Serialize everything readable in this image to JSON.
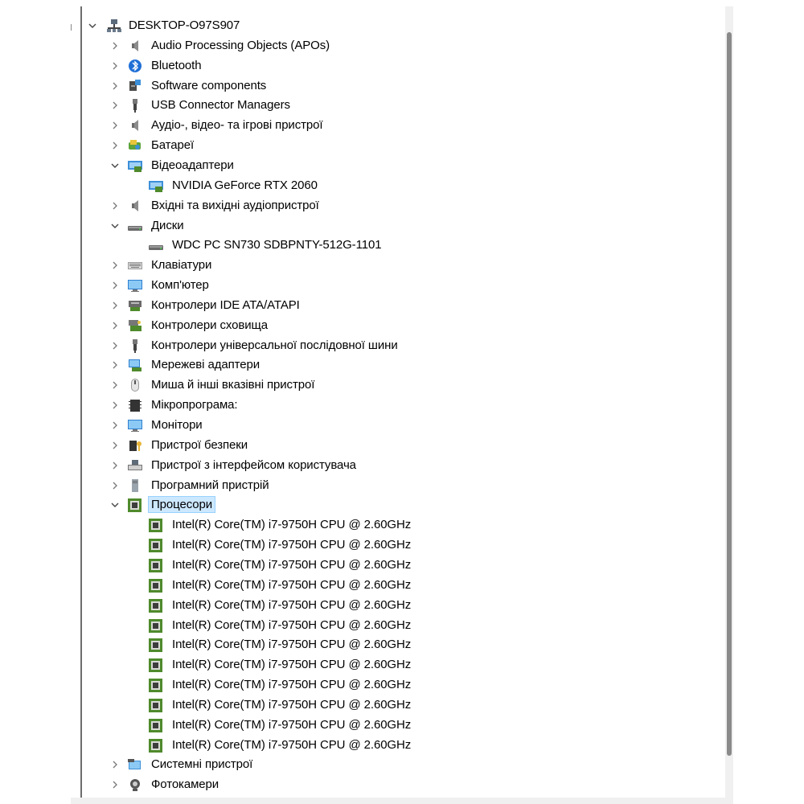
{
  "tree": {
    "root": {
      "label": "DESKTOP-O97S907",
      "icon": "computer-network-icon",
      "expanded": true
    },
    "items": [
      {
        "label": "Audio Processing Objects (APOs)",
        "icon": "speaker-icon",
        "level": 1,
        "chevron": "right"
      },
      {
        "label": "Bluetooth",
        "icon": "bluetooth-icon",
        "level": 1,
        "chevron": "right"
      },
      {
        "label": "Software components",
        "icon": "software-component-icon",
        "level": 1,
        "chevron": "right"
      },
      {
        "label": "USB Connector Managers",
        "icon": "usb-icon",
        "level": 1,
        "chevron": "right"
      },
      {
        "label": "Аудіо-, відео- та ігрові пристрої",
        "icon": "speaker-icon",
        "level": 1,
        "chevron": "right"
      },
      {
        "label": "Батареї",
        "icon": "battery-icon",
        "level": 1,
        "chevron": "right"
      },
      {
        "label": "Відеоадаптери",
        "icon": "display-adapter-icon",
        "level": 1,
        "chevron": "down"
      },
      {
        "label": "NVIDIA GeForce RTX 2060",
        "icon": "display-adapter-icon",
        "level": 2,
        "chevron": "none"
      },
      {
        "label": "Вхідні та вихідні аудіопристрої",
        "icon": "speaker-icon",
        "level": 1,
        "chevron": "right"
      },
      {
        "label": "Диски",
        "icon": "disk-drive-icon",
        "level": 1,
        "chevron": "down"
      },
      {
        "label": "WDC PC SN730 SDBPNTY-512G-1101",
        "icon": "disk-drive-icon",
        "level": 2,
        "chevron": "none"
      },
      {
        "label": "Клавіатури",
        "icon": "keyboard-icon",
        "level": 1,
        "chevron": "right"
      },
      {
        "label": "Комп'ютер",
        "icon": "monitor-icon",
        "level": 1,
        "chevron": "right"
      },
      {
        "label": "Контролери IDE ATA/ATAPI",
        "icon": "ide-controller-icon",
        "level": 1,
        "chevron": "right"
      },
      {
        "label": "Контролери сховища",
        "icon": "storage-controller-icon",
        "level": 1,
        "chevron": "right"
      },
      {
        "label": "Контролери універсальної послідовної шини",
        "icon": "usb-icon",
        "level": 1,
        "chevron": "right"
      },
      {
        "label": "Мережеві адаптери",
        "icon": "network-adapter-icon",
        "level": 1,
        "chevron": "right"
      },
      {
        "label": "Миша й інші вказівні пристрої",
        "icon": "mouse-icon",
        "level": 1,
        "chevron": "right"
      },
      {
        "label": "Мікропрограма:",
        "icon": "firmware-icon",
        "level": 1,
        "chevron": "right"
      },
      {
        "label": "Монітори",
        "icon": "monitor-icon",
        "level": 1,
        "chevron": "right"
      },
      {
        "label": "Пристрої безпеки",
        "icon": "security-device-icon",
        "level": 1,
        "chevron": "right"
      },
      {
        "label": "Пристрої з інтерфейсом користувача",
        "icon": "hid-icon",
        "level": 1,
        "chevron": "right"
      },
      {
        "label": "Програмний пристрій",
        "icon": "software-device-icon",
        "level": 1,
        "chevron": "right"
      },
      {
        "label": "Процесори",
        "icon": "cpu-icon",
        "level": 1,
        "chevron": "down",
        "selected": true
      },
      {
        "label": "Intel(R) Core(TM) i7-9750H CPU @ 2.60GHz",
        "icon": "cpu-icon",
        "level": 2,
        "chevron": "none"
      },
      {
        "label": "Intel(R) Core(TM) i7-9750H CPU @ 2.60GHz",
        "icon": "cpu-icon",
        "level": 2,
        "chevron": "none"
      },
      {
        "label": "Intel(R) Core(TM) i7-9750H CPU @ 2.60GHz",
        "icon": "cpu-icon",
        "level": 2,
        "chevron": "none"
      },
      {
        "label": "Intel(R) Core(TM) i7-9750H CPU @ 2.60GHz",
        "icon": "cpu-icon",
        "level": 2,
        "chevron": "none"
      },
      {
        "label": "Intel(R) Core(TM) i7-9750H CPU @ 2.60GHz",
        "icon": "cpu-icon",
        "level": 2,
        "chevron": "none"
      },
      {
        "label": "Intel(R) Core(TM) i7-9750H CPU @ 2.60GHz",
        "icon": "cpu-icon",
        "level": 2,
        "chevron": "none"
      },
      {
        "label": "Intel(R) Core(TM) i7-9750H CPU @ 2.60GHz",
        "icon": "cpu-icon",
        "level": 2,
        "chevron": "none"
      },
      {
        "label": "Intel(R) Core(TM) i7-9750H CPU @ 2.60GHz",
        "icon": "cpu-icon",
        "level": 2,
        "chevron": "none"
      },
      {
        "label": "Intel(R) Core(TM) i7-9750H CPU @ 2.60GHz",
        "icon": "cpu-icon",
        "level": 2,
        "chevron": "none"
      },
      {
        "label": "Intel(R) Core(TM) i7-9750H CPU @ 2.60GHz",
        "icon": "cpu-icon",
        "level": 2,
        "chevron": "none"
      },
      {
        "label": "Intel(R) Core(TM) i7-9750H CPU @ 2.60GHz",
        "icon": "cpu-icon",
        "level": 2,
        "chevron": "none"
      },
      {
        "label": "Intel(R) Core(TM) i7-9750H CPU @ 2.60GHz",
        "icon": "cpu-icon",
        "level": 2,
        "chevron": "none"
      },
      {
        "label": "Системні пристрої",
        "icon": "system-device-icon",
        "level": 1,
        "chevron": "right"
      },
      {
        "label": "Фотокамери",
        "icon": "camera-icon",
        "level": 1,
        "chevron": "right"
      }
    ]
  },
  "colors": {
    "selection_bg": "#cce8ff",
    "selection_border": "#99d1ff",
    "cpu_green": "#4f8a2c",
    "monitor_blue": "#3c8fd8"
  }
}
